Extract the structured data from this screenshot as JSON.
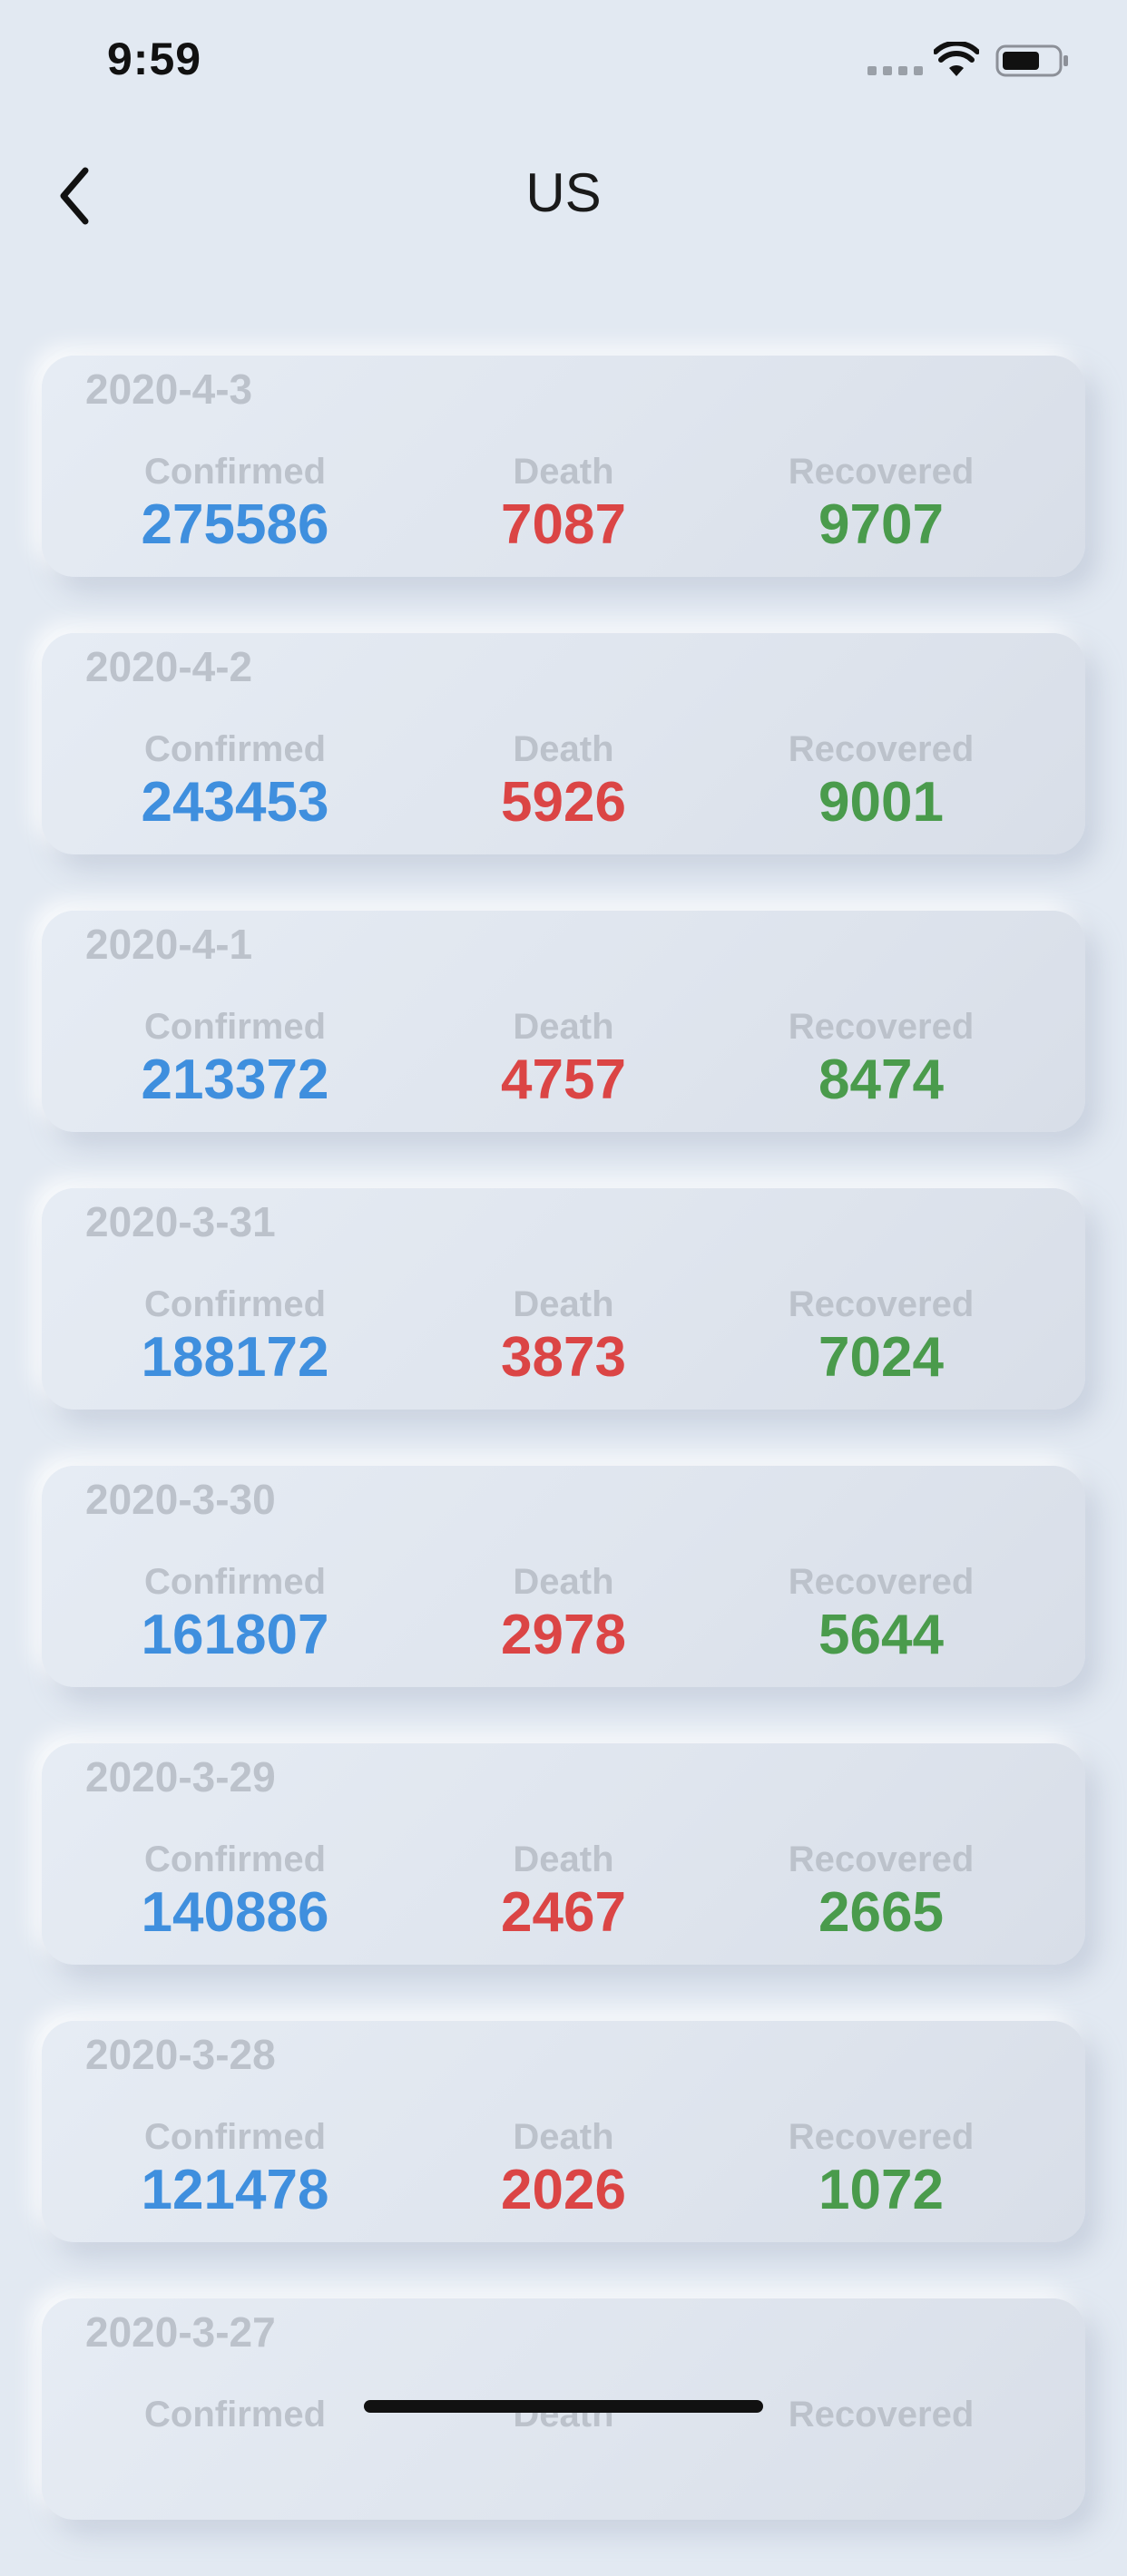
{
  "status_bar": {
    "time": "9:59"
  },
  "header": {
    "title": "US"
  },
  "labels": {
    "confirmed": "Confirmed",
    "death": "Death",
    "recovered": "Recovered"
  },
  "colors": {
    "confirmed": "#3f8fde",
    "death": "#db4545",
    "recovered": "#4a9b4c",
    "label": "#bcc2cb",
    "background": "#e2e9f2"
  },
  "records": [
    {
      "date": "2020-4-3",
      "confirmed": "275586",
      "death": "7087",
      "recovered": "9707"
    },
    {
      "date": "2020-4-2",
      "confirmed": "243453",
      "death": "5926",
      "recovered": "9001"
    },
    {
      "date": "2020-4-1",
      "confirmed": "213372",
      "death": "4757",
      "recovered": "8474"
    },
    {
      "date": "2020-3-31",
      "confirmed": "188172",
      "death": "3873",
      "recovered": "7024"
    },
    {
      "date": "2020-3-30",
      "confirmed": "161807",
      "death": "2978",
      "recovered": "5644"
    },
    {
      "date": "2020-3-29",
      "confirmed": "140886",
      "death": "2467",
      "recovered": "2665"
    },
    {
      "date": "2020-3-28",
      "confirmed": "121478",
      "death": "2026",
      "recovered": "1072"
    },
    {
      "date": "2020-3-27",
      "confirmed": "",
      "death": "",
      "recovered": ""
    }
  ]
}
